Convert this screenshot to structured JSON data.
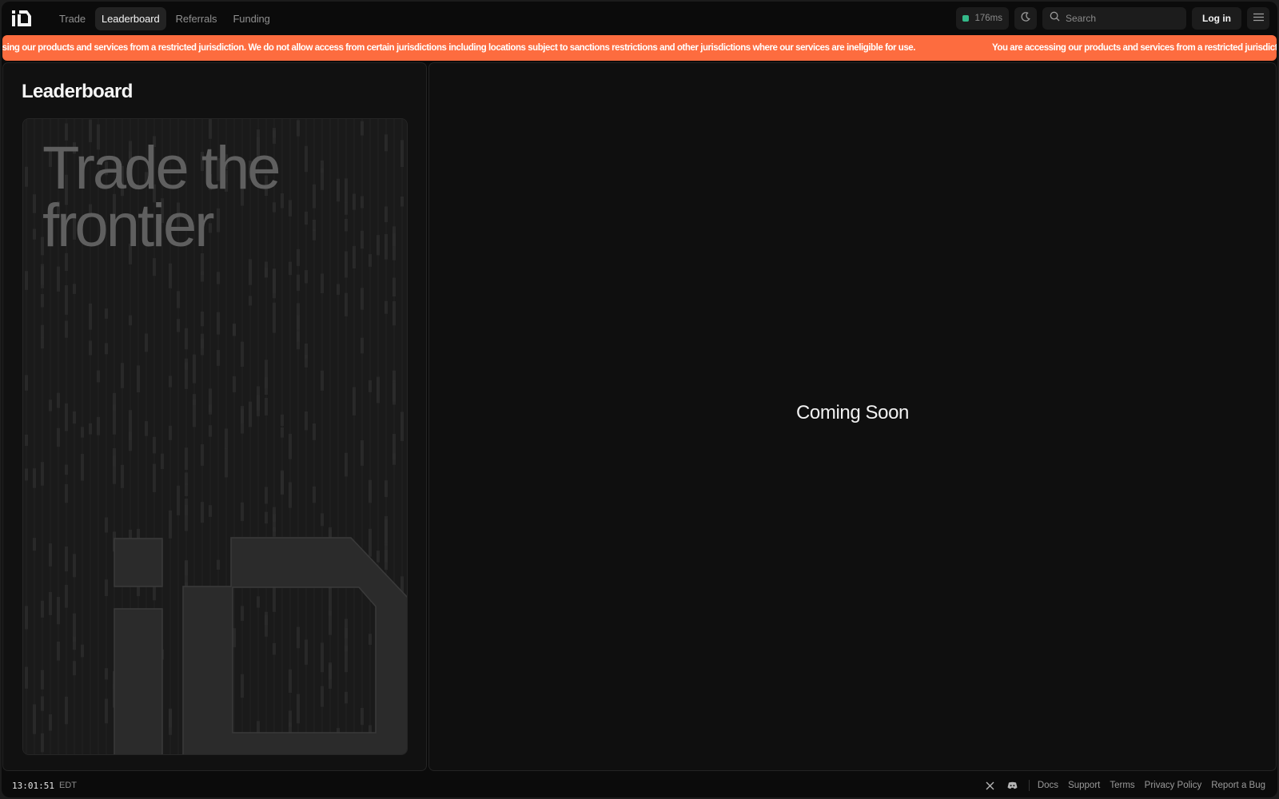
{
  "nav": {
    "tabs": [
      {
        "label": "Trade",
        "active": false
      },
      {
        "label": "Leaderboard",
        "active": true
      },
      {
        "label": "Referrals",
        "active": false
      },
      {
        "label": "Funding",
        "active": false
      }
    ],
    "latency": "176ms",
    "latency_status_color": "#34b989",
    "search_placeholder": "Search",
    "login_label": "Log in",
    "icons": [
      "io-logo",
      "moon-icon",
      "search-icon",
      "menu-icon"
    ]
  },
  "banner": {
    "message": "You are accessing our products and services from a restricted jurisdiction. We do not allow access from certain jurisdictions including locations subject to sanctions restrictions and other jurisdictions where our services are ineligible for use.",
    "color": "#fd6c3f"
  },
  "leaderboard": {
    "title": "Leaderboard",
    "promo_headline_line1": "Trade the",
    "promo_headline_line2": "frontier"
  },
  "main": {
    "status_text": "Coming Soon"
  },
  "footer": {
    "time": "13:01:51",
    "timezone": "EDT",
    "social_icons": [
      "x-icon",
      "discord-icon"
    ],
    "links": [
      "Docs",
      "Support",
      "Terms",
      "Privacy Policy",
      "Report a Bug"
    ]
  }
}
